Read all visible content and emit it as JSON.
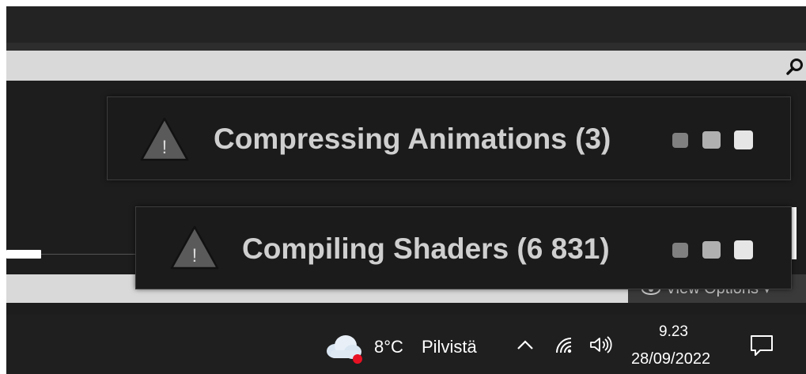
{
  "colors": {
    "app_background": "#1d1d1d",
    "toast_background": "#1b1b1b",
    "toast_text": "#cfcfcf",
    "warning_fill": "#5a5a5a",
    "taskbar": "#1f1f1f",
    "weather_alert_dot": "#e81123"
  },
  "header": {
    "search_icon": "search-icon"
  },
  "view_options": {
    "label": "View Options",
    "icon": "eye-icon",
    "arrow": "dropdown-arrow-icon"
  },
  "notifications": [
    {
      "icon": "warning-icon",
      "title": "Compressing Animations (3)",
      "activity": "throbber-dots"
    },
    {
      "icon": "warning-icon",
      "title": "Compiling Shaders (6 831)",
      "activity": "throbber-dots"
    }
  ],
  "taskbar": {
    "weather": {
      "icon": "cloud-icon",
      "temperature": "8°C",
      "condition": "Pilvistä"
    },
    "tray": {
      "overflow_icon": "chevron-up-icon",
      "network_icon": "wifi-icon",
      "volume_icon": "speaker-icon"
    },
    "clock": {
      "time": "9.23",
      "date": "28/09/2022"
    },
    "notification_center_icon": "notification-icon"
  }
}
